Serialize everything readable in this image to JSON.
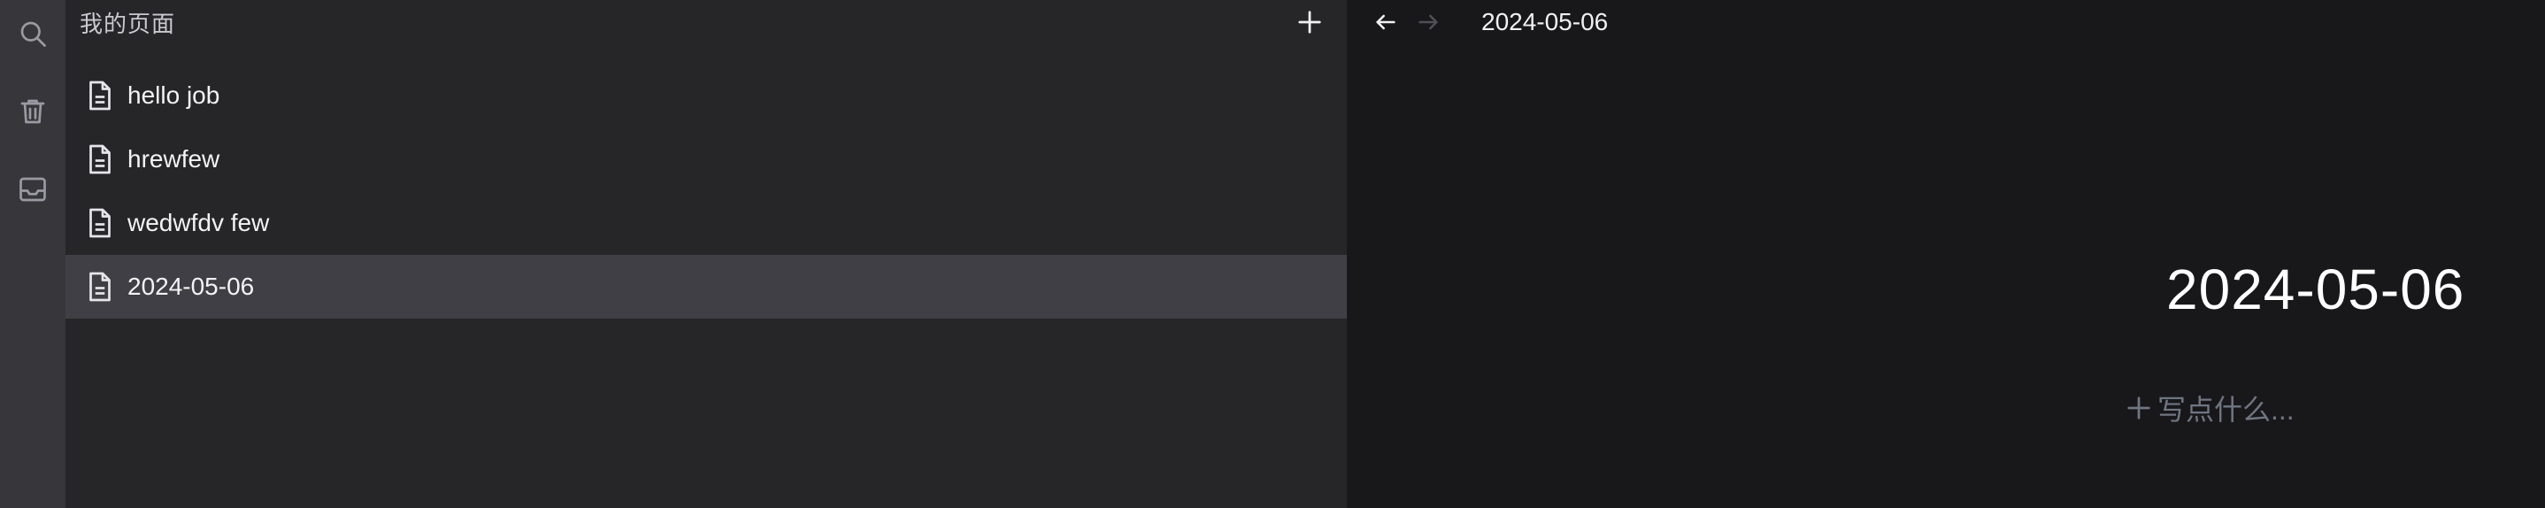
{
  "sidebar": {
    "title": "我的页面",
    "pages": [
      {
        "label": "hello job",
        "selected": false
      },
      {
        "label": "hrewfew",
        "selected": false
      },
      {
        "label": "wedwfdv few",
        "selected": false
      },
      {
        "label": "2024-05-06",
        "selected": true
      }
    ]
  },
  "rail": {
    "icons": [
      "search-icon",
      "trash-icon",
      "inbox-icon"
    ]
  },
  "topbar": {
    "breadcrumb": "2024-05-06"
  },
  "document": {
    "title": "2024-05-06",
    "placeholder": "写点什么..."
  },
  "colors": {
    "rail_bg": "#36363b",
    "sidebar_bg": "#262629",
    "selected_bg": "#3f3f45",
    "main_bg": "#18181b",
    "hint": "#6f7682"
  }
}
